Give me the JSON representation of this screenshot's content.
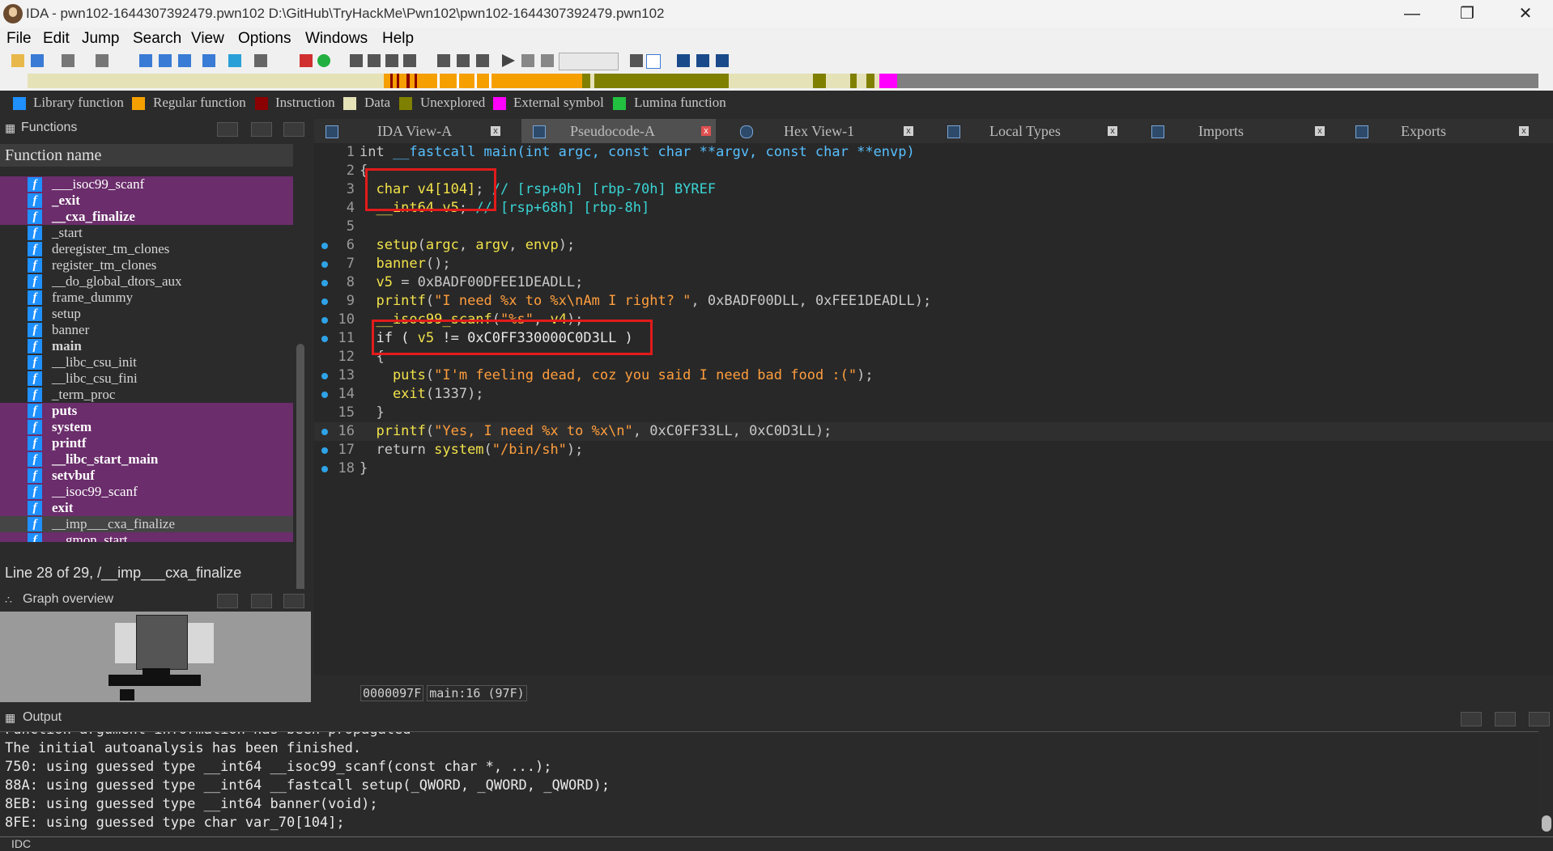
{
  "window": {
    "title": "IDA - pwn102-1644307392479.pwn102 D:\\GitHub\\TryHackMe\\Pwn102\\pwn102-1644307392479.pwn102",
    "minimize": "—",
    "maximize": "❐",
    "close": "✕"
  },
  "menu": [
    "File",
    "Edit",
    "Jump",
    "Search",
    "View",
    "Options",
    "Windows",
    "Help"
  ],
  "legend": [
    {
      "label": "Library function",
      "color": "#1e90ff"
    },
    {
      "label": "Regular function",
      "color": "#f5a000"
    },
    {
      "label": "Instruction",
      "color": "#8b0000"
    },
    {
      "label": "Data",
      "color": "#e6e2b8"
    },
    {
      "label": "Unexplored",
      "color": "#808000"
    },
    {
      "label": "External symbol",
      "color": "#ff00ff"
    },
    {
      "label": "Lumina function",
      "color": "#22c040"
    }
  ],
  "functions_panel": {
    "title": "Functions",
    "column_header": "Function name",
    "items": [
      {
        "name": "___isoc99_scanf",
        "style": "lib"
      },
      {
        "name": "_exit",
        "style": "lib bold"
      },
      {
        "name": "__cxa_finalize",
        "style": "lib bold"
      },
      {
        "name": "_start",
        "style": "reg"
      },
      {
        "name": "deregister_tm_clones",
        "style": "reg"
      },
      {
        "name": "register_tm_clones",
        "style": "reg"
      },
      {
        "name": "__do_global_dtors_aux",
        "style": "reg"
      },
      {
        "name": "frame_dummy",
        "style": "reg"
      },
      {
        "name": "setup",
        "style": "reg"
      },
      {
        "name": "banner",
        "style": "reg"
      },
      {
        "name": "main",
        "style": "reg bold"
      },
      {
        "name": "__libc_csu_init",
        "style": "reg"
      },
      {
        "name": "__libc_csu_fini",
        "style": "reg"
      },
      {
        "name": "_term_proc",
        "style": "reg"
      },
      {
        "name": "puts",
        "style": "lib bold"
      },
      {
        "name": "system",
        "style": "lib bold"
      },
      {
        "name": "printf",
        "style": "lib bold"
      },
      {
        "name": "__libc_start_main",
        "style": "lib bold"
      },
      {
        "name": "setvbuf",
        "style": "lib bold"
      },
      {
        "name": "__isoc99_scanf",
        "style": "lib"
      },
      {
        "name": "exit",
        "style": "lib bold"
      },
      {
        "name": "__imp___cxa_finalize",
        "style": "sel"
      },
      {
        "name": "__gmon_start__",
        "style": "lib"
      }
    ],
    "status": "Line 28 of 29, /__imp___cxa_finalize"
  },
  "graph_overview": {
    "title": "Graph overview"
  },
  "tabs": [
    {
      "label": "IDA View-A",
      "active": false
    },
    {
      "label": "Pseudocode-A",
      "active": true
    },
    {
      "label": "Hex View-1",
      "active": false
    },
    {
      "label": "Local Types",
      "active": false
    },
    {
      "label": "Imports",
      "active": false
    },
    {
      "label": "Exports",
      "active": false
    }
  ],
  "code": {
    "lines": [
      {
        "n": "1",
        "dot": false,
        "parts": [
          [
            "k",
            "int "
          ],
          [
            "b",
            "__fastcall main(int argc, const char **argv, const char **envp)"
          ]
        ]
      },
      {
        "n": "2",
        "dot": false,
        "parts": [
          [
            "k",
            "{"
          ]
        ]
      },
      {
        "n": "3",
        "dot": false,
        "parts": [
          [
            "y",
            "  char v4[104]"
          ],
          [
            "k",
            "; "
          ],
          [
            "c",
            "// [rsp+0h] [rbp-70h] BYREF"
          ]
        ]
      },
      {
        "n": "4",
        "dot": false,
        "parts": [
          [
            "y",
            "  __int64 v5"
          ],
          [
            "k",
            "; "
          ],
          [
            "c",
            "// [rsp+68h] [rbp-8h]"
          ]
        ]
      },
      {
        "n": "5",
        "dot": false,
        "parts": [
          [
            "k",
            ""
          ]
        ]
      },
      {
        "n": "6",
        "dot": true,
        "parts": [
          [
            "y",
            "  setup"
          ],
          [
            "k",
            "("
          ],
          [
            "y",
            "argc"
          ],
          [
            "k",
            ", "
          ],
          [
            "y",
            "argv"
          ],
          [
            "k",
            ", "
          ],
          [
            "y",
            "envp"
          ],
          [
            "k",
            ");"
          ]
        ]
      },
      {
        "n": "7",
        "dot": true,
        "parts": [
          [
            "y",
            "  banner"
          ],
          [
            "k",
            "();"
          ]
        ]
      },
      {
        "n": "8",
        "dot": true,
        "parts": [
          [
            "y",
            "  v5"
          ],
          [
            "k",
            " = 0xBADF00DFEE1DEADLL;"
          ]
        ]
      },
      {
        "n": "9",
        "dot": true,
        "parts": [
          [
            "y",
            "  printf"
          ],
          [
            "k",
            "("
          ],
          [
            "o",
            "\"I need %x to %x\\nAm I right? \""
          ],
          [
            "k",
            ", 0xBADF00DLL, 0xFEE1DEADLL);"
          ]
        ]
      },
      {
        "n": "10",
        "dot": true,
        "parts": [
          [
            "y",
            "  __isoc99_scanf"
          ],
          [
            "k",
            "("
          ],
          [
            "o",
            "\"%s\""
          ],
          [
            "k",
            ", "
          ],
          [
            "y",
            "v4"
          ],
          [
            "k",
            ");"
          ]
        ]
      },
      {
        "n": "11",
        "dot": true,
        "parts": [
          [
            "w",
            "  if ( "
          ],
          [
            "y",
            "v5"
          ],
          [
            "w",
            " != 0xC0FF330000C0D3LL )"
          ]
        ]
      },
      {
        "n": "12",
        "dot": false,
        "parts": [
          [
            "k",
            "  {"
          ]
        ]
      },
      {
        "n": "13",
        "dot": true,
        "parts": [
          [
            "y",
            "    puts"
          ],
          [
            "k",
            "("
          ],
          [
            "o",
            "\"I'm feeling dead, coz you said I need bad food :(\""
          ],
          [
            "k",
            ");"
          ]
        ]
      },
      {
        "n": "14",
        "dot": true,
        "parts": [
          [
            "y",
            "    exit"
          ],
          [
            "k",
            "(1337);"
          ]
        ]
      },
      {
        "n": "15",
        "dot": false,
        "parts": [
          [
            "k",
            "  }"
          ]
        ]
      },
      {
        "n": "16",
        "dot": true,
        "parts": [
          [
            "y",
            "  printf"
          ],
          [
            "k",
            "("
          ],
          [
            "o",
            "\"Yes, I need %x to %x\\n\""
          ],
          [
            "k",
            ", 0xC0FF33LL, 0xC0D3LL);"
          ]
        ]
      },
      {
        "n": "17",
        "dot": true,
        "parts": [
          [
            "k",
            "  return "
          ],
          [
            "y",
            "system"
          ],
          [
            "k",
            "("
          ],
          [
            "o",
            "\"/bin/sh\""
          ],
          [
            "k",
            ");"
          ]
        ]
      },
      {
        "n": "18",
        "dot": true,
        "parts": [
          [
            "k",
            "}"
          ]
        ]
      }
    ],
    "status_addr": "0000097F",
    "status_loc": "main:16 (97F)"
  },
  "output": {
    "title": "Output",
    "lines": [
      "Function argument information has been propagated",
      "The initial autoanalysis has been finished.",
      "750: using guessed type __int64 __isoc99_scanf(const char *, ...);",
      "88A: using guessed type __int64 __fastcall setup(_QWORD, _QWORD, _QWORD);",
      "8EB: using guessed type __int64 banner(void);",
      "8FE: using guessed type char var_70[104];"
    ]
  },
  "idc": "IDC"
}
